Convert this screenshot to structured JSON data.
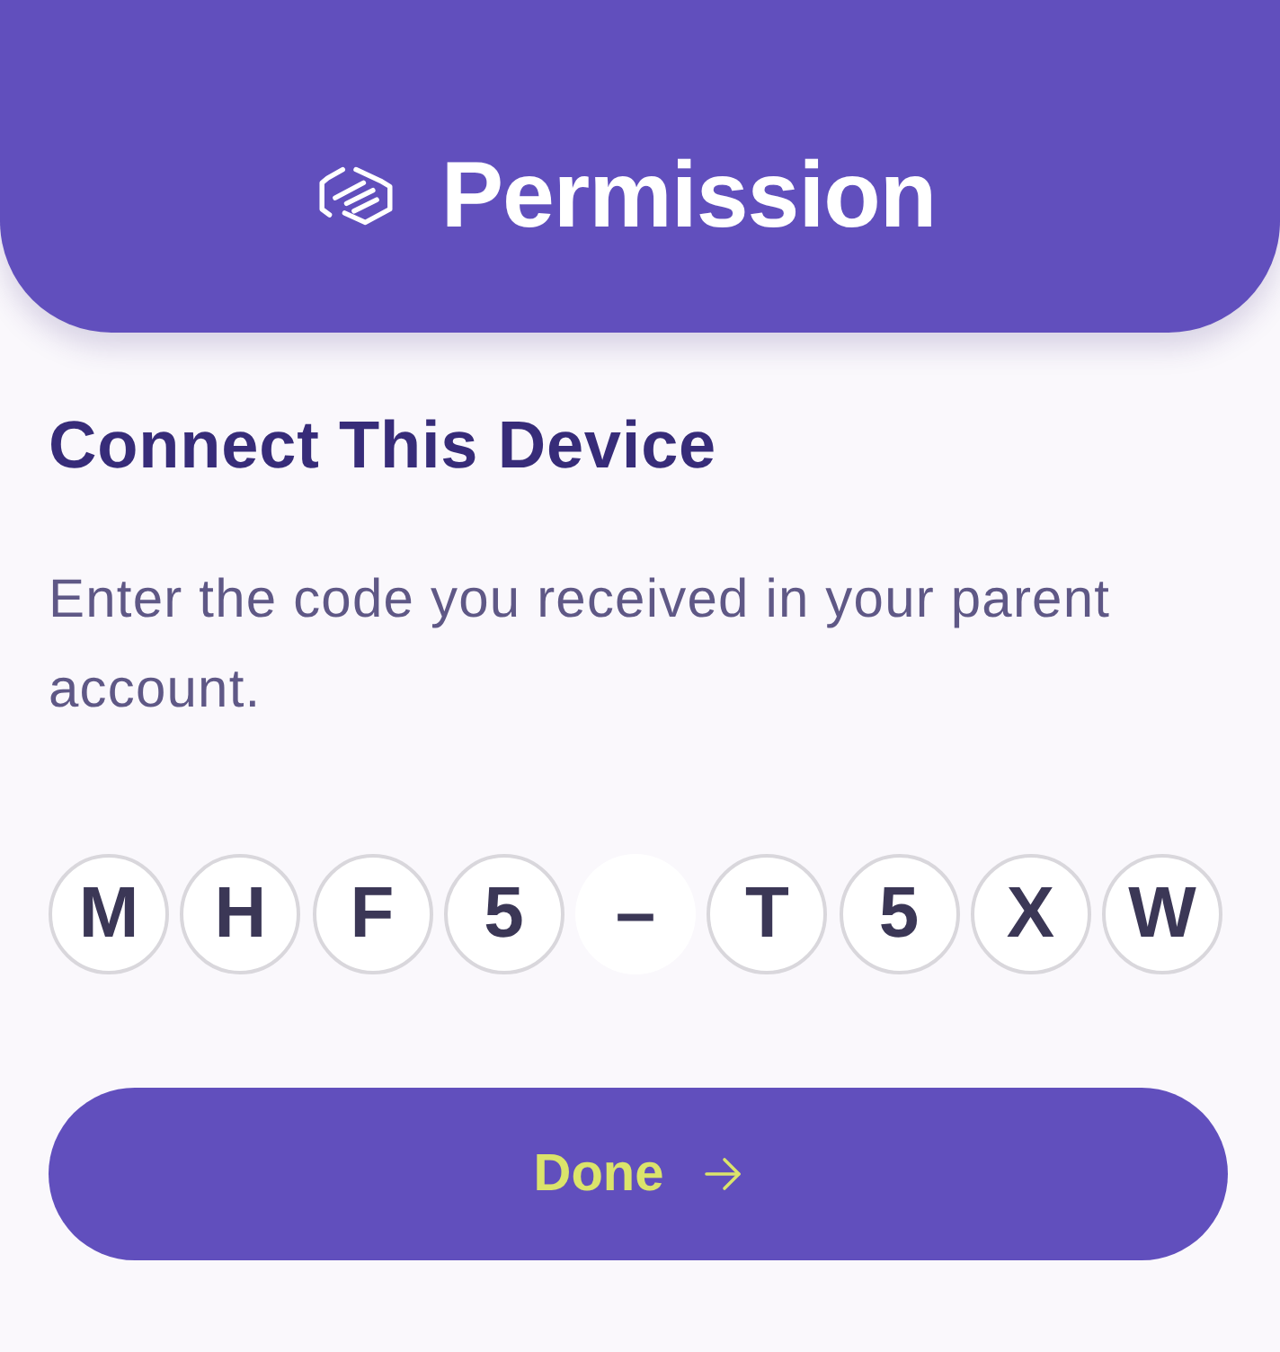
{
  "header": {
    "title": "Permission"
  },
  "heading": "Connect This Device",
  "instructions": "Enter the code you received in your parent account.",
  "code": [
    {
      "kind": "character",
      "text": "M"
    },
    {
      "kind": "character",
      "text": "H"
    },
    {
      "kind": "character",
      "text": "F"
    },
    {
      "kind": "character",
      "text": "5"
    },
    {
      "kind": "separator",
      "text": "–"
    },
    {
      "kind": "character",
      "text": "T"
    },
    {
      "kind": "character",
      "text": "5"
    },
    {
      "kind": "character",
      "text": "X"
    },
    {
      "kind": "character",
      "text": "W"
    }
  ],
  "done_button": {
    "label": "Done"
  }
}
